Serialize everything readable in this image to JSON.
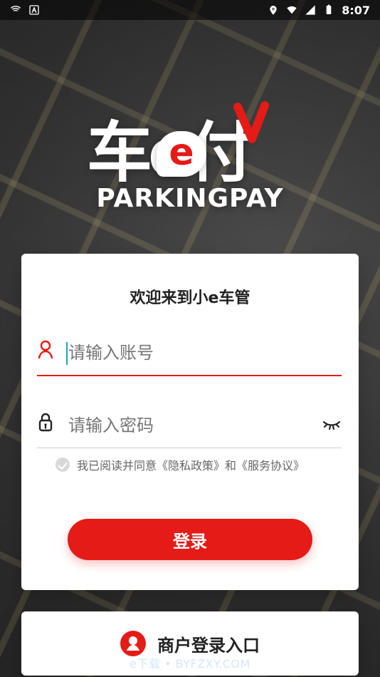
{
  "status_bar": {
    "time": "8:07"
  },
  "brand": {
    "logo_chinese": "车e付",
    "logo_english": "PARKINGPAY",
    "accent": "#e41b17"
  },
  "login_card": {
    "title": "欢迎来到小e车管",
    "account_placeholder": "请输入账号",
    "password_placeholder": "请输入密码",
    "agreement_text": "我已阅读并同意《隐私政策》和《服务协议》",
    "login_button": "登录"
  },
  "merchant": {
    "label": "商户登录入口"
  },
  "watermark": {
    "text": "e下载 • BYFZXY.COM"
  },
  "icons": {
    "account": "user-icon",
    "password": "lock-icon",
    "toggle_password": "eye-closed-icon",
    "agree": "check-circle-icon",
    "merchant": "merchant-user-icon"
  }
}
